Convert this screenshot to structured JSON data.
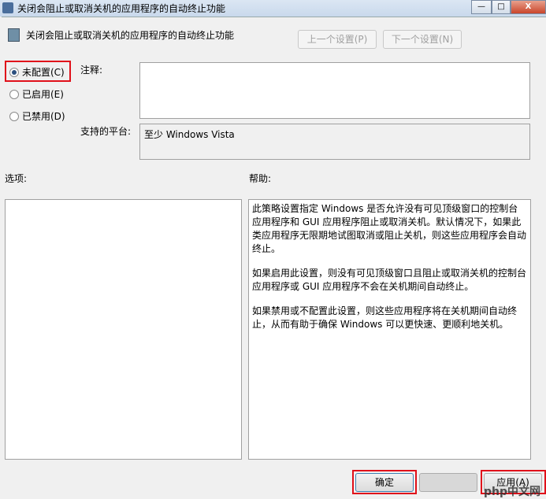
{
  "window": {
    "title": "关闭会阻止或取消关机的应用程序的自动终止功能",
    "minimize": "—",
    "maximize": "□",
    "close": "X"
  },
  "header": {
    "title": "关闭会阻止或取消关机的应用程序的自动终止功能",
    "prev_button": "上一个设置(P)",
    "next_button": "下一个设置(N)"
  },
  "options": [
    {
      "label": "未配置(C)",
      "selected": true
    },
    {
      "label": "已启用(E)",
      "selected": false
    },
    {
      "label": "已禁用(D)",
      "selected": false
    }
  ],
  "comment_label": "注释:",
  "comment_value": "",
  "platform_label": "支持的平台:",
  "platform_value": "至少 Windows Vista",
  "options_label": "选项:",
  "help_label": "帮助:",
  "help": [
    "此策略设置指定 Windows 是否允许没有可见顶级窗口的控制台应用程序和 GUI 应用程序阻止或取消关机。默认情况下，如果此类应用程序无限期地试图取消或阻止关机，则这些应用程序会自动终止。",
    "如果启用此设置，则没有可见顶级窗口且阻止或取消关机的控制台应用程序或 GUI 应用程序不会在关机期间自动终止。",
    "如果禁用或不配置此设置，则这些应用程序将在关机期间自动终止，从而有助于确保 Windows 可以更快速、更顺利地关机。"
  ],
  "footer": {
    "ok": "确定",
    "cancel": "",
    "apply": "应用(A)"
  },
  "watermark": "php中文网"
}
